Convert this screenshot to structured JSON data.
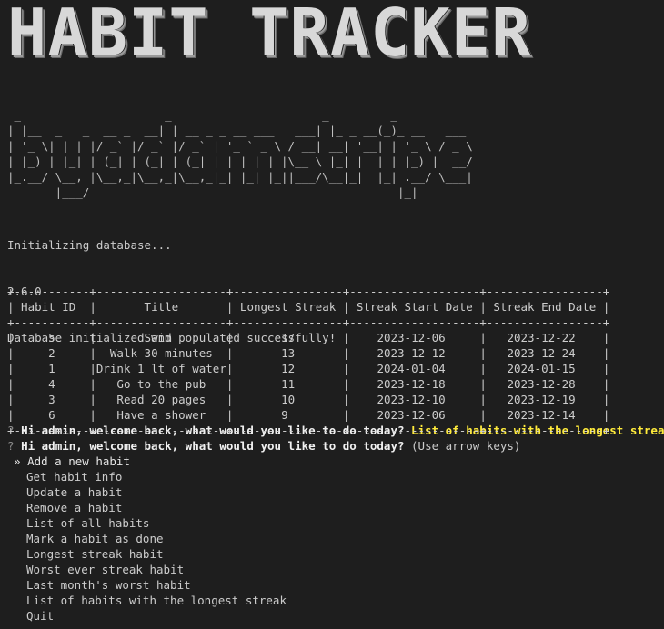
{
  "banner": {
    "title": "HABIT TRACKER",
    "subtitle_ascii": " _                     _                      _         _\n| |__  _   _  __ _  __| | __ _ _ __ ___   ___| |_ _ __(_)_ __   ___\n| '_ \\| | | |/ _` |/ _` |/ _` | '_ ` _ \\ / __| __| '__| | '_ \\ / _ \\\n| |_) | |_| | (_| | (_| | (_| | | | | | |\\__ \\ |_| |  | | |_) |  __/\n|_.__/ \\__, |\\__,_|\\__,_|\\__,_|_| |_| |_||___/\\__|_|  |_| .__/ \\___|\n       |___/                                             |_|"
  },
  "log": [
    "Initializing database...",
    "2.6.0",
    "Database initialized and populated successfully!"
  ],
  "prompt1": {
    "mark": "?",
    "question": "Hi admin, welcome back, what would you like to do today?",
    "answer": "List of habits with the longest streak"
  },
  "table": {
    "border": "+-----------+-------------------+----------------+-------------------+-----------------+",
    "columns": [
      "Habit ID",
      "Title",
      "Longest Streak",
      "Streak Start Date",
      "Streak End Date"
    ],
    "rows": [
      [
        "5",
        "Swim",
        "17",
        "2023-12-06",
        "2023-12-22"
      ],
      [
        "2",
        "Walk 30 minutes",
        "13",
        "2023-12-12",
        "2023-12-24"
      ],
      [
        "1",
        "Drink 1 lt of water",
        "12",
        "2024-01-04",
        "2024-01-15"
      ],
      [
        "4",
        "Go to the pub",
        "11",
        "2023-12-18",
        "2023-12-28"
      ],
      [
        "3",
        "Read 20 pages",
        "10",
        "2023-12-10",
        "2023-12-19"
      ],
      [
        "6",
        "Have a shower",
        "9",
        "2023-12-06",
        "2023-12-14"
      ]
    ]
  },
  "prompt2": {
    "mark": "?",
    "question": "Hi admin, welcome back, what would you like to do today?",
    "hint": "(Use arrow keys)"
  },
  "menu": {
    "pointer": "»",
    "items": [
      "Add a new habit",
      "Get habit info",
      "Update a habit",
      "Remove a habit",
      "List of all habits",
      "Mark a habit as done",
      "Longest streak habit",
      "Worst ever streak habit",
      "Last month's worst habit",
      "List of habits with the longest streak",
      "Quit"
    ],
    "selected_index": 0
  }
}
